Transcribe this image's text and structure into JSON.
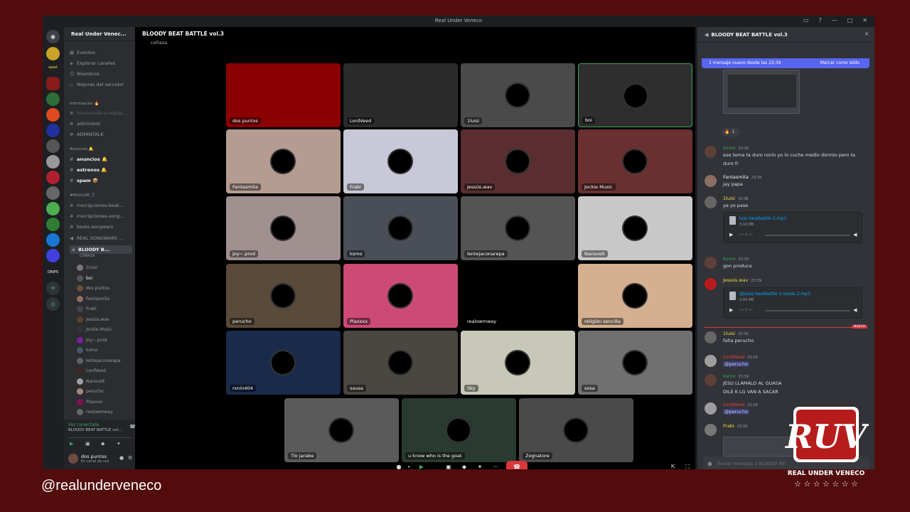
{
  "window": {
    "title": "Real Under Veneco"
  },
  "server": {
    "name": "Real Under Venec..."
  },
  "channels": {
    "top": [
      "Eventos",
      "Explorar canales",
      "Miembros",
      "Mejoras del servidor"
    ],
    "cat_info": "Información 🔥",
    "info": [
      "bienvenida-y-reglas...",
      "admintext",
      "ADMINTALK"
    ],
    "cat_anuncios": "Anuncios 🔔",
    "anuncios": [
      "anuncios 🔔",
      "estrenos 🔔",
      "spam 📦"
    ],
    "cat_ruv": "#RUVLIVE 🎵",
    "ruv": [
      "inscripciones-beat-...",
      "inscripciones-song...",
      "beats-songwars",
      "REAL SONGWARS ..."
    ],
    "current_voice": "BLOODY B...",
    "current_voice_sub": "COÑAZA",
    "voice_users": [
      "1luisi",
      "boi",
      "dos puntos",
      "Fantasmita",
      "Frabi",
      "Jessús.wav",
      "Jockie Music",
      "Joy~.prod",
      "ksmo",
      "lentejaconarepa",
      "LordVeed",
      "Nansvelt",
      "perucho",
      "Plaxxxx",
      "realowmway"
    ]
  },
  "user_panel": {
    "status": "Voz conectada",
    "channel": "BLOODY BEAT BATTLE vol...",
    "username": "dos puntos",
    "user_status": "En canal de voz"
  },
  "call": {
    "title": "BLOODY BEAT BATTLE vol.3",
    "subtitle": "coñaza",
    "tiles": [
      "dos puntos",
      "LordVeed",
      "1luisi",
      "boi",
      "Fantasmita",
      "Frabi",
      "Jessús.wav",
      "Jockie Music",
      "Joy~.prod",
      "ksmo",
      "lentejaconarepa",
      "Nansvelt",
      "perucho",
      "Plaxxxx",
      "realowmway",
      "religión sencilla",
      "rxnin404",
      "sausa",
      "Sky",
      "sosa",
      "Tío jarabe",
      "u know who is the goat",
      "Zognatore"
    ]
  },
  "chat": {
    "title": "BLOODY BEAT BATTLE vol.3",
    "new_banner": "1 mensaje nuevo desde las 23:39",
    "mark_read": "Marcar como leído",
    "reaction_count": "1",
    "new_divider": "NUEVO",
    "input_placeholder": "Enviar mensaje a BLOODY BE",
    "messages": [
      {
        "author": "ksmo",
        "time": "23:38",
        "text": "ese tema ta duro ronin yo lo cuche medio dormio pero ta duro fr",
        "color": "#3ba55c"
      },
      {
        "author": "Fantasmita",
        "time": "23:38",
        "text": "jay papa",
        "color": "#f2f3f5"
      },
      {
        "author": "1luisi",
        "time": "23:38",
        "text": "ya yo pase",
        "color": "#f0e142"
      },
      {
        "author": "ksmo",
        "time": "23:39",
        "text": "gon produce",
        "color": "#3ba55c"
      },
      {
        "author": "Jessús.wav",
        "time": "23:39",
        "text": "",
        "color": "#f0e142"
      },
      {
        "author": "1luisi",
        "time": "23:39",
        "text": "falta perucho",
        "color": "#f0e142"
      },
      {
        "author": "LordVeed",
        "time": "23:39",
        "text": "@perucho",
        "color": "#ed4245"
      },
      {
        "author": "ksmo",
        "time": "23:39",
        "text": "JESU LLAMALO AL GUASA",
        "text2": "DILE K LG VAN A SACAR",
        "color": "#3ba55c"
      },
      {
        "author": "LordVeed",
        "time": "23:39",
        "text": "@perucho",
        "color": "#ed4245"
      },
      {
        "author": "Frabi",
        "time": "23:39",
        "text": "",
        "color": "#f0e142"
      }
    ],
    "attachments": [
      {
        "name": "luisi beatbattle 2.mp3",
        "size": "3.16 MB",
        "time": "-:-- / -:--"
      },
      {
        "name": "@jeszz beatbattle 3 ronda 2.mp3",
        "size": "3.04 MB",
        "time": "-:-- / -:--"
      }
    ]
  },
  "overlay": {
    "handle": "@realunderveneco",
    "logo_text": "REAL UNDER VENECO",
    "logo_mark": "RUV"
  },
  "colors": {
    "bg": "#520c0c",
    "accent": "#5865f2",
    "danger": "#da373c",
    "green": "#3ba55c"
  }
}
